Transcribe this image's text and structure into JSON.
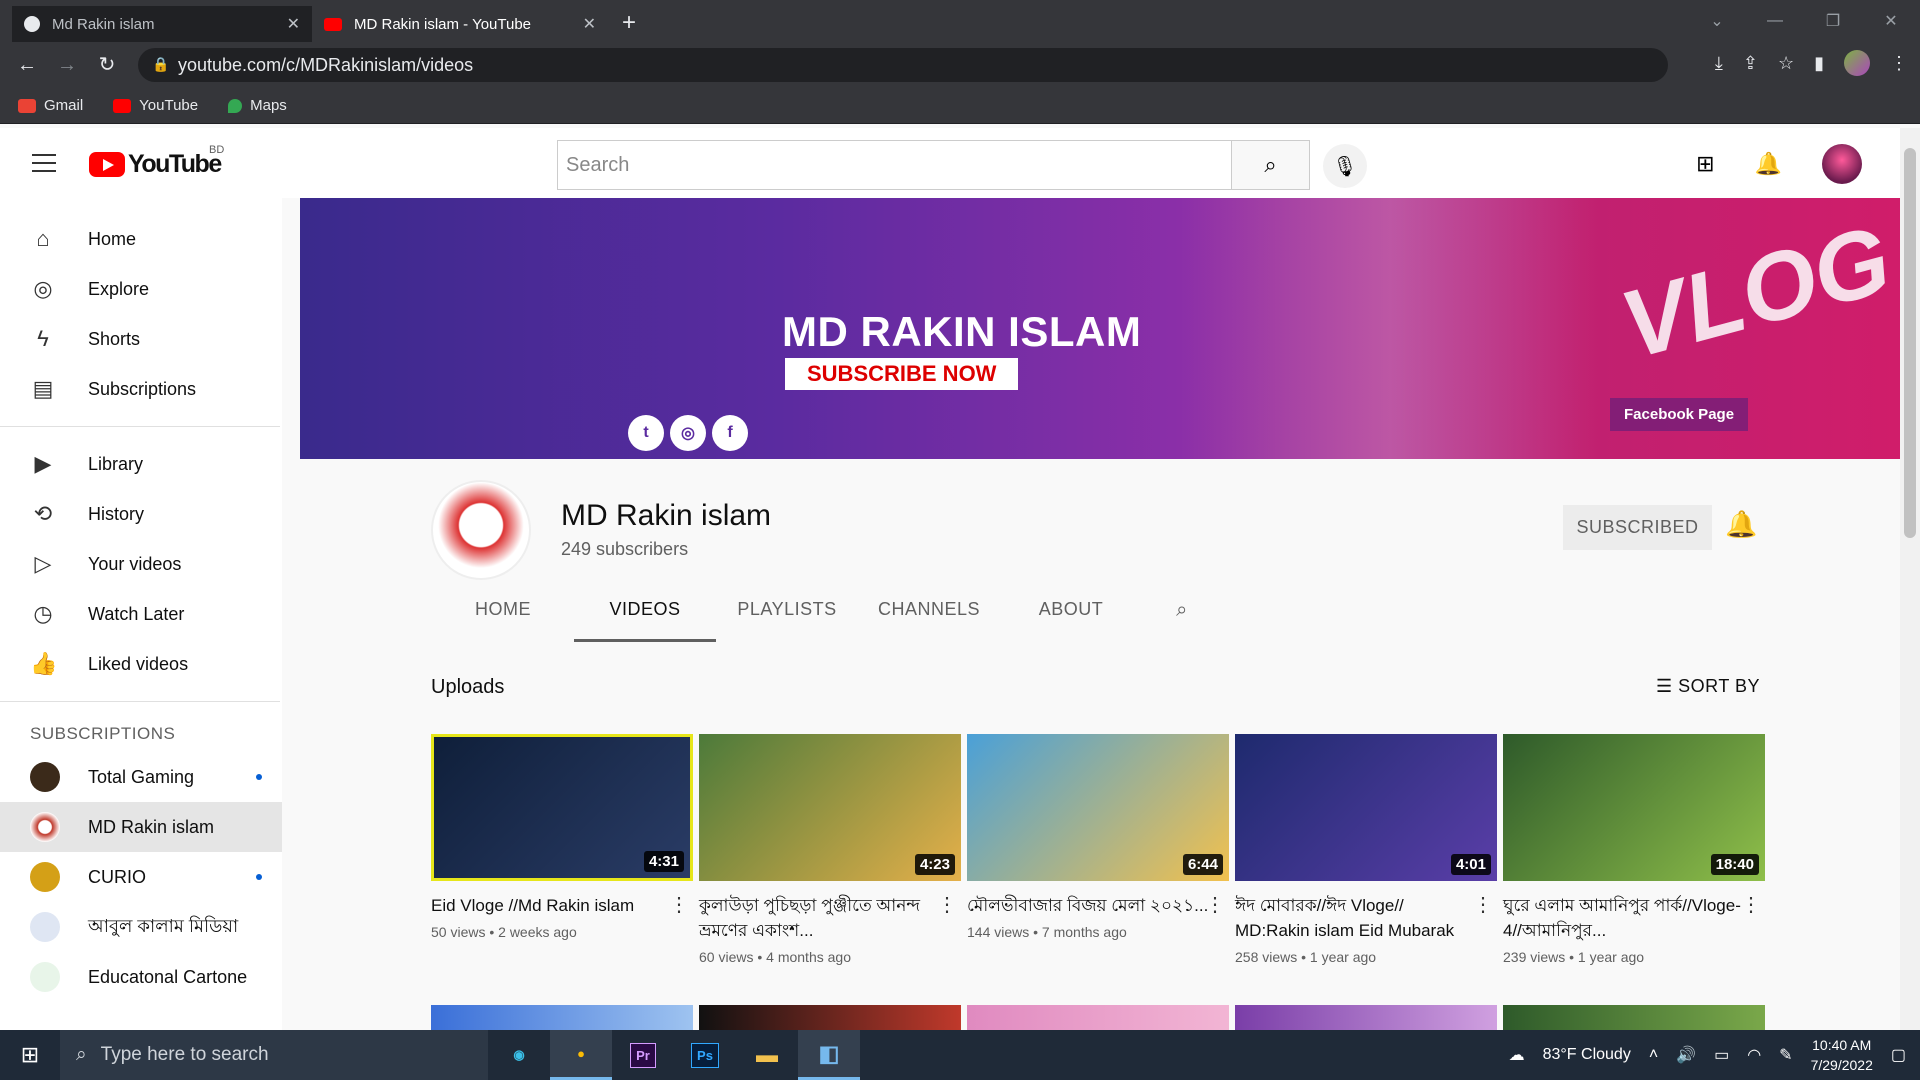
{
  "browser": {
    "tabs": [
      {
        "title": "Md Rakin islam",
        "active": false
      },
      {
        "title": "MD Rakin islam - YouTube",
        "active": true
      }
    ],
    "url": "youtube.com/c/MDRakinislam/videos",
    "bookmarks": [
      {
        "label": "Gmail",
        "color": "#ea4335"
      },
      {
        "label": "YouTube",
        "color": "#ff0000"
      },
      {
        "label": "Maps",
        "color": "#34a853"
      }
    ]
  },
  "header": {
    "logo_text": "YouTube",
    "country_code": "BD",
    "search_placeholder": "Search"
  },
  "sidebar": {
    "main_items": [
      {
        "label": "Home",
        "icon": "home-icon"
      },
      {
        "label": "Explore",
        "icon": "explore-icon"
      },
      {
        "label": "Shorts",
        "icon": "shorts-icon"
      },
      {
        "label": "Subscriptions",
        "icon": "subscriptions-icon"
      }
    ],
    "library_items": [
      {
        "label": "Library",
        "icon": "library-icon"
      },
      {
        "label": "History",
        "icon": "history-icon"
      },
      {
        "label": "Your videos",
        "icon": "your-videos-icon"
      },
      {
        "label": "Watch Later",
        "icon": "watch-later-icon"
      },
      {
        "label": "Liked videos",
        "icon": "liked-icon"
      }
    ],
    "subscriptions_heading": "SUBSCRIPTIONS",
    "subscriptions": [
      {
        "label": "Total Gaming",
        "new": true,
        "color": "#3b2a1a"
      },
      {
        "label": "MD Rakin islam",
        "new": false,
        "active": true,
        "color": "#c0392b"
      },
      {
        "label": "CURIO",
        "new": true,
        "color": "#d4a017"
      },
      {
        "label": "আবুল কালাম মিডিয়া",
        "new": false,
        "color": "#8aa0c8"
      },
      {
        "label": "Educatonal Cartone",
        "new": false,
        "color": "#c8e6c9"
      }
    ]
  },
  "banner": {
    "title": "MD RAKIN ISLAM",
    "subscribe_text": "SUBSCRIBE NOW",
    "facebook_label": "Facebook Page",
    "vlog_text": "VLOG"
  },
  "channel": {
    "name": "MD Rakin islam",
    "subscribers": "249 subscribers",
    "subscribed_label": "SUBSCRIBED",
    "tabs": [
      "HOME",
      "VIDEOS",
      "PLAYLISTS",
      "CHANNELS",
      "ABOUT"
    ],
    "active_tab": "VIDEOS"
  },
  "uploads": {
    "heading": "Uploads",
    "sort_label": "SORT BY",
    "videos": [
      {
        "title": "Eid Vloge //Md Rakin islam",
        "meta": "50 views • 2 weeks ago",
        "duration": "4:31",
        "thumb": "linear-gradient(135deg,#0f1f3a,#2a3c66)"
      },
      {
        "title": "কুলাউড়া পুচিছড়া পুঞ্জীতে আনন্দ ভ্রমণের একাংশ...",
        "meta": "60 views • 4 months ago",
        "duration": "4:23",
        "thumb": "linear-gradient(135deg,#4c7a3a,#e5b04a)"
      },
      {
        "title": "মৌলভীবাজার বিজয় মেলা ২০২১...",
        "meta": "144 views • 7 months ago",
        "duration": "6:44",
        "thumb": "linear-gradient(135deg,#4aa0d8,#f2c14e)"
      },
      {
        "title": "ঈদ মোবারক//ঈদ Vloge// MD:Rakin islam Eid Mubarak",
        "meta": "258 views • 1 year ago",
        "duration": "4:01",
        "thumb": "linear-gradient(135deg,#1e2a6e,#5a3ea8)"
      },
      {
        "title": "ঘুরে এলাম আমানিপুর পার্ক//Vloge-4//আমানিপুর...",
        "meta": "239 views • 1 year ago",
        "duration": "18:40",
        "thumb": "linear-gradient(135deg,#2e5a2a,#8fbf4a)"
      }
    ]
  },
  "taskbar": {
    "search_placeholder": "Type here to search",
    "weather": "83°F  Cloudy",
    "time": "10:40 AM",
    "date": "7/29/2022",
    "apps": [
      "Edge",
      "Chrome",
      "Pr",
      "Ps",
      "Explorer",
      "App"
    ]
  }
}
